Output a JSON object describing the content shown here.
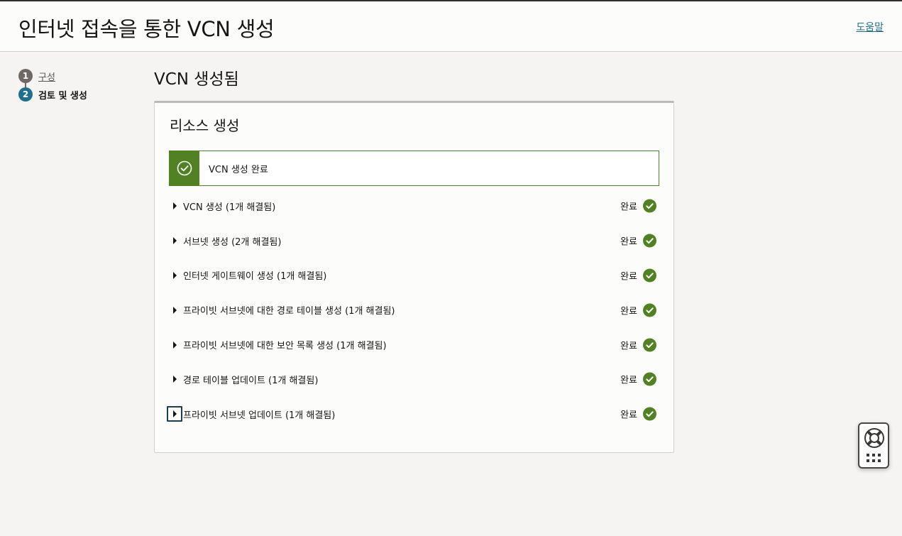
{
  "header": {
    "title": "인터넷 접속을 통한 VCN 생성",
    "help_label": "도움말"
  },
  "steps": [
    {
      "number": "1",
      "label": "구성",
      "state": "done"
    },
    {
      "number": "2",
      "label": "검토 및 생성",
      "state": "current"
    }
  ],
  "page_title": "VCN 생성됨",
  "card": {
    "title": "리소스 생성",
    "banner": {
      "text": "VCN 생성 완료",
      "icon": "check-circle-icon"
    },
    "items": [
      {
        "label": "VCN 생성 (1개 해결됨)",
        "status": "완료"
      },
      {
        "label": "서브넷 생성 (2개 해결됨)",
        "status": "완료"
      },
      {
        "label": "인터넷 게이트웨이 생성 (1개 해결됨)",
        "status": "완료"
      },
      {
        "label": "프라이빗 서브넷에 대한 경로 테이블 생성 (1개 해결됨)",
        "status": "완료"
      },
      {
        "label": "프라이빗 서브넷에 대한 보안 목록 생성 (1개 해결됨)",
        "status": "완료"
      },
      {
        "label": "경로 테이블 업데이트 (1개 해결됨)",
        "status": "완료"
      },
      {
        "label": "프라이빗 서브넷 업데이트 (1개 해결됨)",
        "status": "완료"
      }
    ]
  },
  "helper": {
    "icon": "lifebuoy-icon",
    "menu_icon": "grid-dots-icon"
  },
  "colors": {
    "accent": "#1f6f8e",
    "success": "#508223",
    "header_bg": "#fcfcfb",
    "page_bg": "#f5f4f2"
  }
}
